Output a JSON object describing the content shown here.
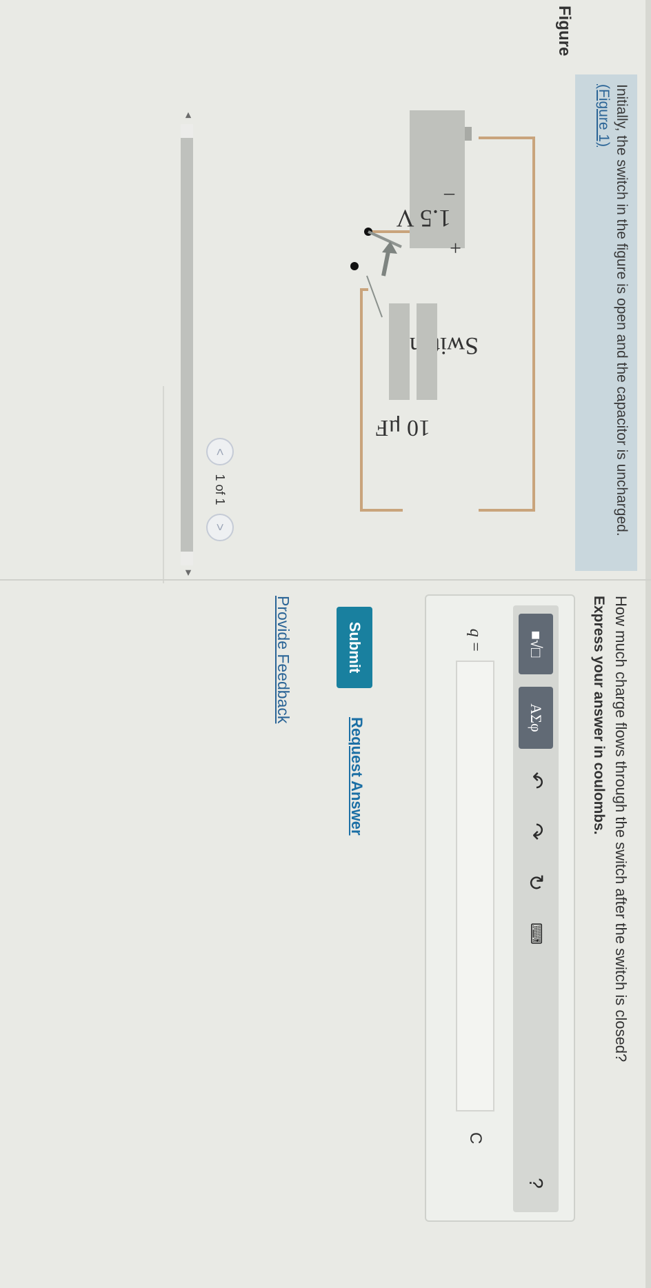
{
  "intro": {
    "text": "Initially, the switch in the figure is open and the capacitor is uncharged.",
    "figure_link": "(Figure 1)"
  },
  "figure": {
    "label": "Figure",
    "battery_plus": "+",
    "battery_voltage": "1.5 V",
    "battery_minus": "–",
    "switch_label": "Switch",
    "capacitor_label": "10 μF",
    "pager": {
      "prev_icon": "<",
      "position": "1 of 1",
      "next_icon": ">"
    },
    "scroll_left": "◄",
    "scroll_right": "►"
  },
  "question": {
    "text": "How much charge flows through the switch after the switch is closed?",
    "instruction": "Express your answer in coulombs."
  },
  "answer": {
    "toolbar": {
      "template_symbol": "■√□",
      "greek_symbol": "ΑΣφ",
      "undo_icon": "↶",
      "redo_icon": "↷",
      "reset_icon": "↻",
      "keyboard_icon": "⌨",
      "help_icon": "?"
    },
    "variable": "q =",
    "value": "",
    "unit": "C"
  },
  "actions": {
    "submit": "Submit",
    "request_answer": "Request Answer",
    "provide_feedback": "Provide Feedback"
  }
}
